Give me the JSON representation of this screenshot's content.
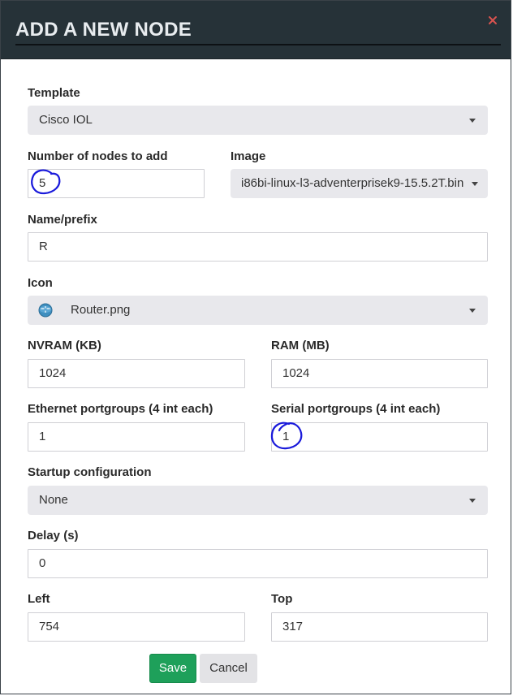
{
  "header": {
    "title": "ADD A NEW NODE",
    "close_icon": "close-x-icon",
    "close_color": "#d9534f"
  },
  "form": {
    "template": {
      "label": "Template",
      "value": "Cisco IOL"
    },
    "node_count": {
      "label": "Number of nodes to add",
      "value": "5"
    },
    "image": {
      "label": "Image",
      "value": "i86bi-linux-l3-adventerprisek9-15.5.2T.bin"
    },
    "name_prefix": {
      "label": "Name/prefix",
      "value": "R"
    },
    "icon": {
      "label": "Icon",
      "value": "Router.png",
      "icon_name": "router-icon"
    },
    "nvram": {
      "label": "NVRAM (KB)",
      "value": "1024"
    },
    "ram": {
      "label": "RAM (MB)",
      "value": "1024"
    },
    "ethernet": {
      "label": "Ethernet portgroups (4 int each)",
      "value": "1"
    },
    "serial": {
      "label": "Serial portgroups (4 int each)",
      "value": "1"
    },
    "startup": {
      "label": "Startup configuration",
      "value": "None"
    },
    "delay": {
      "label": "Delay (s)",
      "value": "0"
    },
    "left": {
      "label": "Left",
      "value": "754"
    },
    "top": {
      "label": "Top",
      "value": "317"
    }
  },
  "buttons": {
    "save": "Save",
    "cancel": "Cancel"
  },
  "colors": {
    "header_bg": "#263238",
    "save_bg": "#1ea05a",
    "annotation": "#1a1adb"
  }
}
